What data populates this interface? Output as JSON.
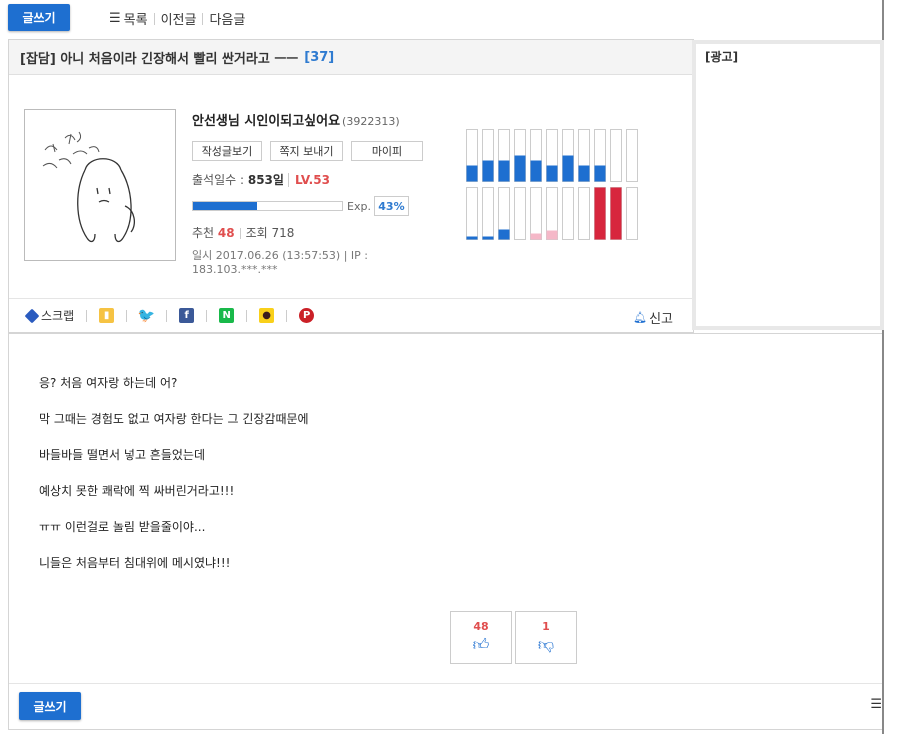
{
  "topbar": {
    "write_label": "글쓰기",
    "nav": [
      "목록",
      "이전글",
      "다음글"
    ]
  },
  "post": {
    "title": "[잡담] 아니 처음이라 긴장해서 빨리 싼거라고 ㅡㅡ",
    "comment_count": "[37]"
  },
  "profile": {
    "nickname": "안선생님 시인이되고싶어요",
    "user_id": "(3922313)",
    "buttons": [
      "작성글보기",
      "쪽지 보내기",
      "마이피"
    ],
    "attend_label": "출석일수 : ",
    "attend_days": "853일",
    "level": "LV.53",
    "exp_label": "Exp.",
    "exp_percent": "43%",
    "exp_fraction": 0.43,
    "recommend_label": "추천",
    "recommend_value": "48",
    "views_label": "조회 718",
    "date_ip": "일시 2017.06.26 (13:57:53) | IP : 183.103.***.***"
  },
  "activity_graph": {
    "top_row": [
      0.3,
      0.4,
      0.4,
      0.5,
      0.4,
      0.3,
      0.5,
      0.3,
      0.3,
      0,
      0
    ],
    "bottom_row": [
      {
        "v": 0.05,
        "c": "#1e6fd0"
      },
      {
        "v": 0.05,
        "c": "#1e6fd0"
      },
      {
        "v": 0.2,
        "c": "#1e6fd0"
      },
      {
        "v": 0,
        "c": "#1e6fd0"
      },
      {
        "v": 0.12,
        "c": "#f5b8c8"
      },
      {
        "v": 0.18,
        "c": "#f5b8c8"
      },
      {
        "v": 0,
        "c": "#1e6fd0"
      },
      {
        "v": 0,
        "c": "#1e6fd0"
      },
      {
        "v": 1.0,
        "c": "#d7263d"
      },
      {
        "v": 1.0,
        "c": "#d7263d"
      },
      {
        "v": 0,
        "c": "#1e6fd0"
      }
    ]
  },
  "share": {
    "scrap_label": "스크랩",
    "icons": [
      {
        "name": "kakaostory-icon",
        "color": "#f6c343",
        "glyph": "▮"
      },
      {
        "name": "twitter-icon",
        "color": "#1da1f2",
        "glyph": "🐦"
      },
      {
        "name": "facebook-icon",
        "color": "#3b5998",
        "glyph": "f"
      },
      {
        "name": "naver-icon",
        "color": "#19b94a",
        "glyph": "N"
      },
      {
        "name": "kakaotalk-icon",
        "color": "#f9d01a",
        "glyph": "●"
      },
      {
        "name": "pinterest-icon",
        "color": "#cb2027",
        "glyph": "P"
      }
    ],
    "report_label": "신고"
  },
  "ad": {
    "label": "[광고]"
  },
  "body_lines": [
    "응? 처음 여자랑 하는데 어?",
    "막 그때는 경험도 없고 여자랑 한다는 그 긴장감때문에",
    "바들바들 떨면서 넣고 흔들었는데",
    "예상치 못한 쾌락에 찍 싸버린거라고!!!",
    "ㅠㅠ 이런걸로 놀림 받을줄이야...",
    "니들은 처음부터 침대위에 메시였냐!!!"
  ],
  "votes": {
    "up": "48",
    "down": "1"
  },
  "bottom": {
    "write_label": "글쓰기"
  }
}
